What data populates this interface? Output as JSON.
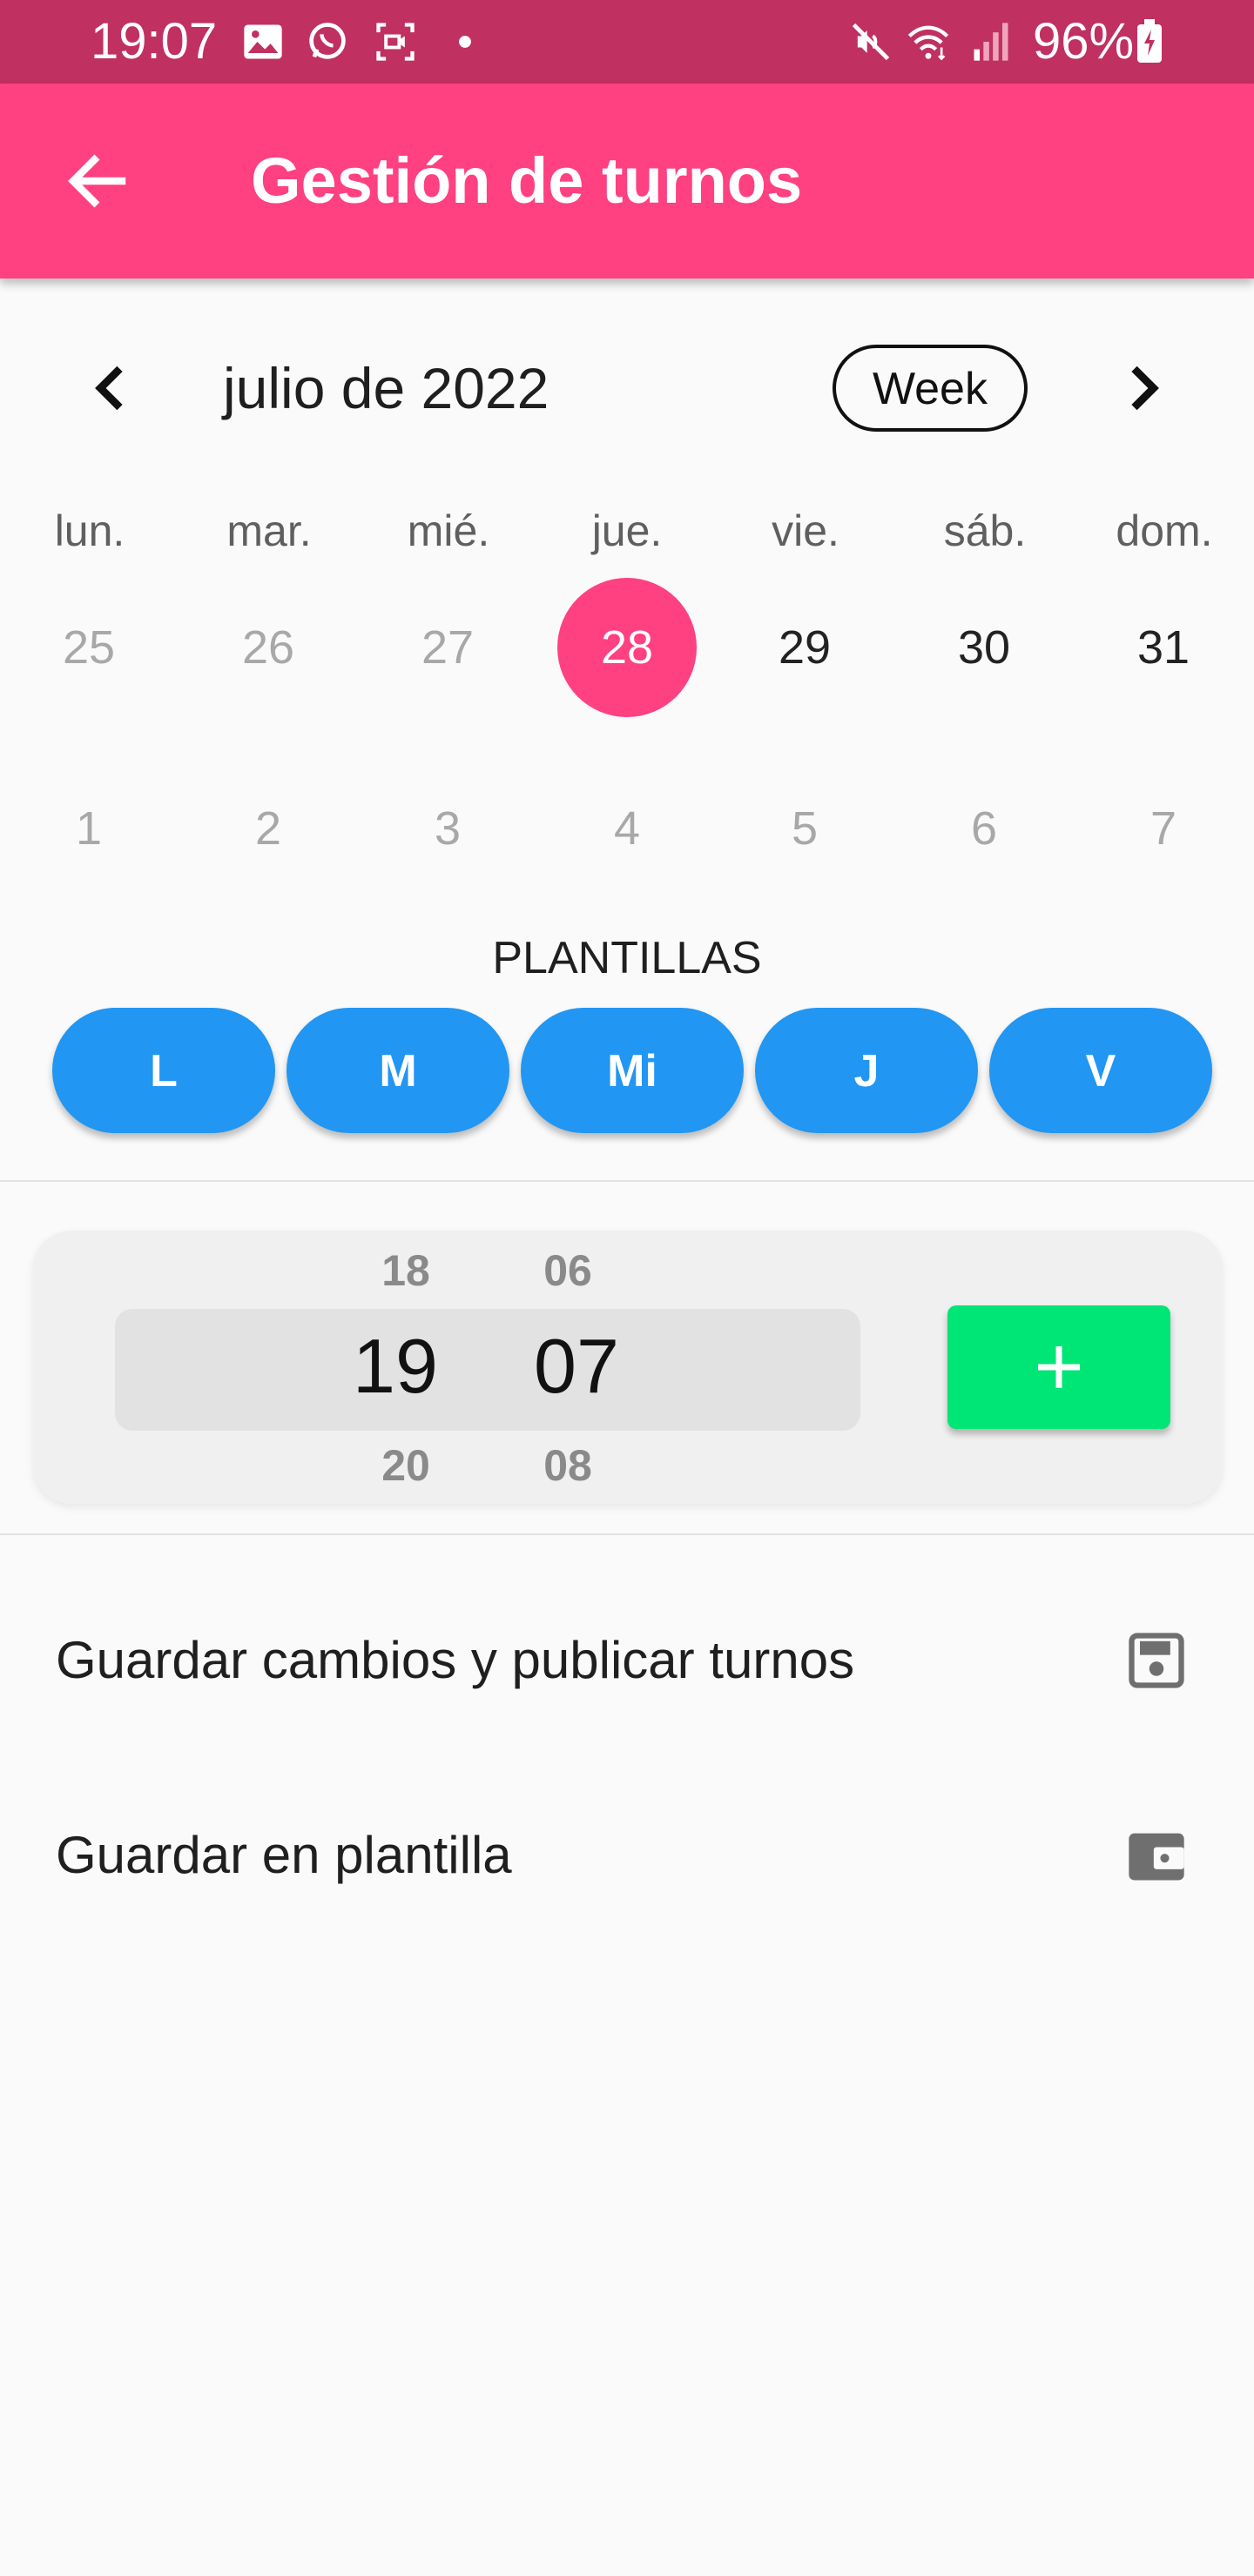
{
  "status_bar": {
    "time": "19:07",
    "battery": "96%",
    "icons": [
      "image-icon",
      "whatsapp-icon",
      "screen-record-icon",
      "dot-icon",
      "mute-icon",
      "wifi-icon",
      "signal-icon",
      "battery-charging-icon"
    ]
  },
  "app_bar": {
    "title": "Gestión de turnos",
    "back_icon": "arrow-back-icon"
  },
  "calendar": {
    "month_label": "julio de 2022",
    "view_toggle": "Week",
    "prev_icon": "chevron-left-icon",
    "next_icon": "chevron-right-icon",
    "weekdays": [
      "lun.",
      "mar.",
      "mié.",
      "jue.",
      "vie.",
      "sáb.",
      "dom."
    ],
    "week1": [
      "25",
      "26",
      "27",
      "28",
      "29",
      "30",
      "31"
    ],
    "week2": [
      "1",
      "2",
      "3",
      "4",
      "5",
      "6",
      "7"
    ],
    "selected_date": "28"
  },
  "templates": {
    "title": "PLANTILLAS",
    "buttons": [
      "L",
      "M",
      "Mi",
      "J",
      "V"
    ]
  },
  "time_picker": {
    "hour_prev": "18",
    "hour": "19",
    "hour_next": "20",
    "minute_prev": "06",
    "minute": "07",
    "minute_next": "08",
    "add_icon": "plus-icon"
  },
  "actions": {
    "publish": {
      "label": "Guardar cambios y publicar turnos",
      "icon": "save-icon"
    },
    "template": {
      "label": "Guardar en plantilla",
      "icon": "wallet-icon"
    }
  },
  "colors": {
    "status_bar": "#c03060",
    "app_bar": "#ff4081",
    "selected_date": "#ff4081",
    "template_button": "#2196f3",
    "add_button": "#00e676"
  }
}
